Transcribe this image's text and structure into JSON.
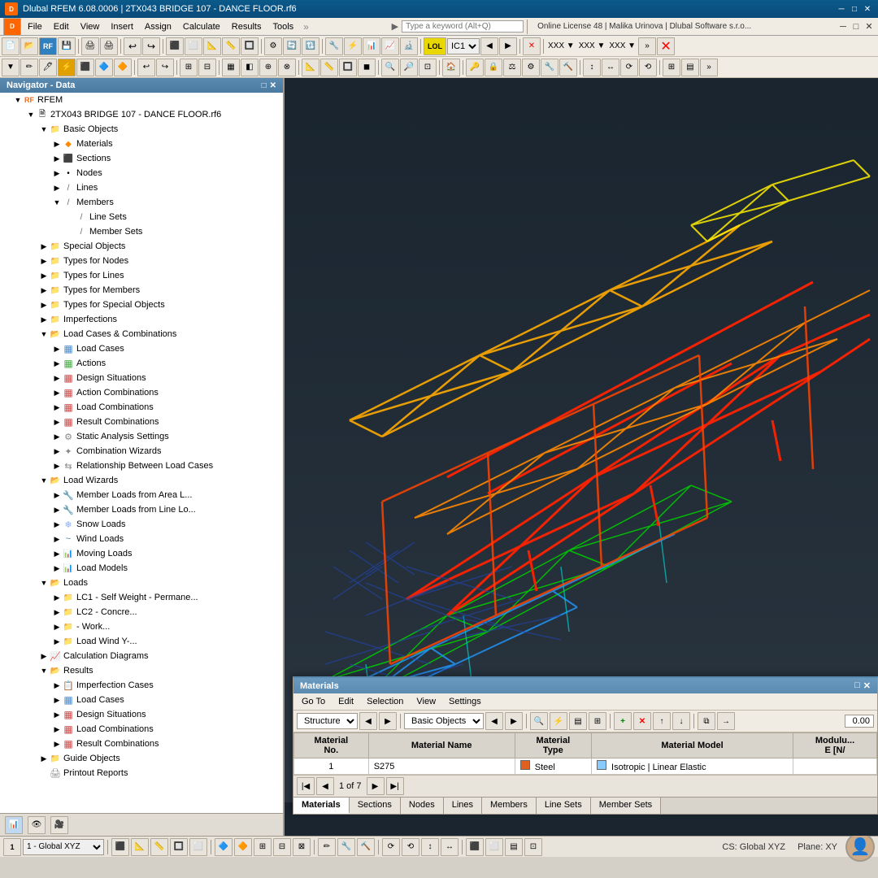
{
  "titleBar": {
    "icon": "D",
    "title": "Dlubal RFEM 6.08.0006 | 2TX043 BRIDGE 107 - DANCE FLOOR.rf6",
    "controls": [
      "_",
      "□",
      "×"
    ]
  },
  "menuBar": {
    "items": [
      "File",
      "Edit",
      "View",
      "Insert",
      "Assign",
      "Calculate",
      "Results",
      "Tools"
    ],
    "searchPlaceholder": "Type a keyword (Alt+Q)",
    "licenseInfo": "Online License 48 | Malika Urinova | Dlubal Software s.r.o..."
  },
  "navigator": {
    "title": "Navigator - Data",
    "rfem": {
      "label": "RFEM",
      "project": "2TX043 BRIDGE 107 - DANCE FLOOR.rf6",
      "tree": [
        {
          "id": "basic-objects",
          "label": "Basic Objects",
          "level": 1,
          "expanded": true,
          "icon": "📁"
        },
        {
          "id": "materials",
          "label": "Materials",
          "level": 2,
          "icon": "🔶"
        },
        {
          "id": "sections",
          "label": "Sections",
          "level": 2,
          "icon": "🔷"
        },
        {
          "id": "nodes",
          "label": "Nodes",
          "level": 2,
          "icon": "•"
        },
        {
          "id": "lines",
          "label": "Lines",
          "level": 2,
          "icon": "/"
        },
        {
          "id": "members",
          "label": "Members",
          "level": 2,
          "expanded": true,
          "icon": "/"
        },
        {
          "id": "line-sets",
          "label": "Line Sets",
          "level": 3,
          "icon": "/"
        },
        {
          "id": "member-sets",
          "label": "Member Sets",
          "level": 3,
          "icon": "/"
        },
        {
          "id": "special-objects",
          "label": "Special Objects",
          "level": 1,
          "icon": "📁"
        },
        {
          "id": "types-nodes",
          "label": "Types for Nodes",
          "level": 1,
          "icon": "📁"
        },
        {
          "id": "types-lines",
          "label": "Types for Lines",
          "level": 1,
          "icon": "📁"
        },
        {
          "id": "types-members",
          "label": "Types for Members",
          "level": 1,
          "icon": "📁"
        },
        {
          "id": "types-special",
          "label": "Types for Special Objects",
          "level": 1,
          "icon": "📁"
        },
        {
          "id": "imperfections",
          "label": "Imperfections",
          "level": 1,
          "icon": "📁"
        },
        {
          "id": "load-cases-comb",
          "label": "Load Cases & Combinations",
          "level": 1,
          "expanded": true,
          "icon": "📂"
        },
        {
          "id": "load-cases",
          "label": "Load Cases",
          "level": 2,
          "icon": "📋"
        },
        {
          "id": "actions",
          "label": "Actions",
          "level": 2,
          "icon": "📋"
        },
        {
          "id": "design-situations",
          "label": "Design Situations",
          "level": 2,
          "icon": "📋"
        },
        {
          "id": "action-combinations",
          "label": "Action Combinations",
          "level": 2,
          "icon": "📋"
        },
        {
          "id": "load-combinations",
          "label": "Load Combinations",
          "level": 2,
          "icon": "📋"
        },
        {
          "id": "result-combinations",
          "label": "Result Combinations",
          "level": 2,
          "icon": "📋"
        },
        {
          "id": "static-analysis",
          "label": "Static Analysis Settings",
          "level": 2,
          "icon": "📋"
        },
        {
          "id": "combination-wizards",
          "label": "Combination Wizards",
          "level": 2,
          "icon": "📋"
        },
        {
          "id": "relationship-load",
          "label": "Relationship Between Load Cases",
          "level": 2,
          "icon": "📋"
        },
        {
          "id": "load-wizards",
          "label": "Load Wizards",
          "level": 1,
          "expanded": true,
          "icon": "📂"
        },
        {
          "id": "member-loads-area",
          "label": "Member Loads from Area L...",
          "level": 2,
          "icon": "🔧"
        },
        {
          "id": "member-loads-line",
          "label": "Member Loads from Line Lo...",
          "level": 2,
          "icon": "🔧"
        },
        {
          "id": "snow-loads",
          "label": "Snow Loads",
          "level": 2,
          "icon": "❄"
        },
        {
          "id": "wind-loads",
          "label": "Wind Loads",
          "level": 2,
          "icon": "~"
        },
        {
          "id": "moving-loads",
          "label": "Moving Loads",
          "level": 2,
          "icon": "📊"
        },
        {
          "id": "load-models",
          "label": "Load Models",
          "level": 2,
          "icon": "📊"
        },
        {
          "id": "loads",
          "label": "Loads",
          "level": 1,
          "expanded": true,
          "icon": "📂"
        },
        {
          "id": "lc1",
          "label": "LC1 - Self Weight - Permane...",
          "level": 2,
          "icon": "📁"
        },
        {
          "id": "lc2",
          "label": "LC2 - Concre...",
          "level": 2,
          "icon": "📁"
        },
        {
          "id": "work",
          "label": "- Work...",
          "level": 2,
          "icon": "📁"
        },
        {
          "id": "load-wind-y",
          "label": "Load Wind Y-...",
          "level": 2,
          "icon": "📁"
        },
        {
          "id": "calc-diagrams",
          "label": "Calculation Diagrams",
          "level": 1,
          "icon": "📈"
        },
        {
          "id": "results",
          "label": "Results",
          "level": 1,
          "expanded": true,
          "icon": "📂"
        },
        {
          "id": "imperfection-cases",
          "label": "Imperfection Cases",
          "level": 2,
          "icon": "📋"
        },
        {
          "id": "res-load-cases",
          "label": "Load Cases",
          "level": 2,
          "icon": "📋"
        },
        {
          "id": "res-design-sit",
          "label": "Design Situations",
          "level": 2,
          "icon": "📋"
        },
        {
          "id": "res-load-comb",
          "label": "Load Combinations",
          "level": 2,
          "icon": "📋"
        },
        {
          "id": "res-result-comb",
          "label": "Result Combinations",
          "level": 2,
          "icon": "📋"
        },
        {
          "id": "guide-objects",
          "label": "Guide Objects",
          "level": 1,
          "icon": "📁"
        },
        {
          "id": "printout-reports",
          "label": "Printout Reports",
          "level": 1,
          "icon": "🖨"
        }
      ]
    }
  },
  "materialsPanel": {
    "title": "Materials",
    "menus": [
      "Go To",
      "Edit",
      "Selection",
      "View",
      "Settings"
    ],
    "toolbar": {
      "dropdown1": "Structure",
      "dropdown2": "Basic Objects"
    },
    "table": {
      "headers": [
        "Material No.",
        "Material Name",
        "Material Type",
        "Material Model",
        "Modulus E [N/"
      ],
      "rows": [
        {
          "no": "1",
          "name": "S275",
          "type": "Steel",
          "typeColor": "#e06020",
          "model": "Isotropic | Linear Elastic"
        }
      ]
    },
    "pagination": "1 of 7",
    "tabs": [
      "Materials",
      "Sections",
      "Nodes",
      "Lines",
      "Members",
      "Line Sets",
      "Member Sets"
    ]
  },
  "statusBar": {
    "cs": "CS: Global XYZ",
    "plane": "Plane: XY"
  },
  "bottomBar": {
    "coord": "1 - Global XYZ"
  }
}
